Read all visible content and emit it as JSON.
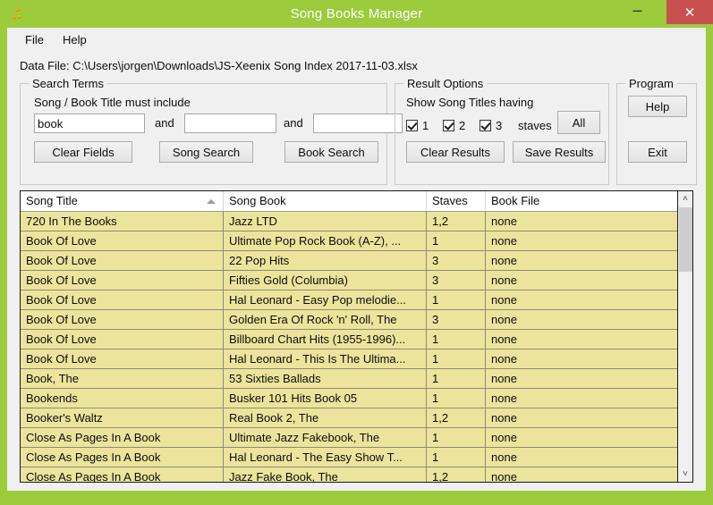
{
  "window": {
    "title": "Song Books Manager",
    "icon": "music-note-icon",
    "titlebar_color": "#9ccb3c",
    "close_button_color": "#c8504f",
    "minimize_label": "–",
    "maximize_label": "",
    "close_label": "✕"
  },
  "menubar": {
    "items": [
      {
        "label": "File"
      },
      {
        "label": "Help"
      }
    ]
  },
  "datafile": {
    "text": "Data File: C:\\Users\\jorgen\\Downloads\\JS-Xeenix Song Index 2017-11-03.xlsx"
  },
  "search_terms": {
    "legend": "Search Terms",
    "caption": "Song / Book Title must include",
    "field1": {
      "value": "book",
      "placeholder": ""
    },
    "and1": "and",
    "field2": {
      "value": "",
      "placeholder": ""
    },
    "and2": "and",
    "field3": {
      "value": "",
      "placeholder": ""
    },
    "clear_fields_label": "Clear Fields",
    "song_search_label": "Song Search",
    "book_search_label": "Book Search"
  },
  "result_options": {
    "legend": "Result Options",
    "caption": "Show Song Titles having",
    "checkboxes": [
      {
        "label": "1",
        "checked": true
      },
      {
        "label": "2",
        "checked": true
      },
      {
        "label": "3",
        "checked": true
      }
    ],
    "staves_label": "staves",
    "all_label": "All",
    "clear_results_label": "Clear Results",
    "save_results_label": "Save Results"
  },
  "program": {
    "legend": "Program",
    "help_label": "Help",
    "exit_label": "Exit"
  },
  "results_table": {
    "row_color": "#ece49c",
    "sort_column": "Song Title",
    "sort_direction": "ascending",
    "columns": [
      "Song Title",
      "Song Book",
      "Staves",
      "Book File"
    ],
    "rows": [
      [
        "720 In The Books",
        "Jazz LTD",
        "1,2",
        "none"
      ],
      [
        "Book Of Love",
        "Ultimate Pop Rock Book (A-Z), ...",
        "1",
        "none"
      ],
      [
        "Book Of Love",
        "22 Pop Hits",
        "3",
        "none"
      ],
      [
        "Book Of Love",
        "Fifties Gold (Columbia)",
        "3",
        "none"
      ],
      [
        "Book Of Love",
        "Hal Leonard - Easy Pop melodie...",
        "1",
        "none"
      ],
      [
        "Book Of Love",
        "Golden Era Of Rock 'n' Roll, The",
        "3",
        "none"
      ],
      [
        "Book Of Love",
        "Billboard Chart Hits (1955-1996)...",
        "1",
        "none"
      ],
      [
        "Book Of Love",
        "Hal Leonard - This Is The Ultima...",
        "1",
        "none"
      ],
      [
        "Book, The",
        "53 Sixties Ballads",
        "1",
        "none"
      ],
      [
        "Bookends",
        "Busker 101 Hits Book 05",
        "1",
        "none"
      ],
      [
        "Booker's Waltz",
        "Real Book 2, The",
        "1,2",
        "none"
      ],
      [
        "Close As Pages In A Book",
        "Ultimate Jazz Fakebook, The",
        "1",
        "none"
      ],
      [
        "Close As Pages In A Book",
        "Hal Leonard - The Easy Show T...",
        "1",
        "none"
      ],
      [
        "Close As Pages In A Book",
        "Jazz Fake Book, The",
        "1,2",
        "none"
      ]
    ]
  },
  "scrollbar": {
    "up_arrow": "˄",
    "down_arrow": "˅"
  }
}
